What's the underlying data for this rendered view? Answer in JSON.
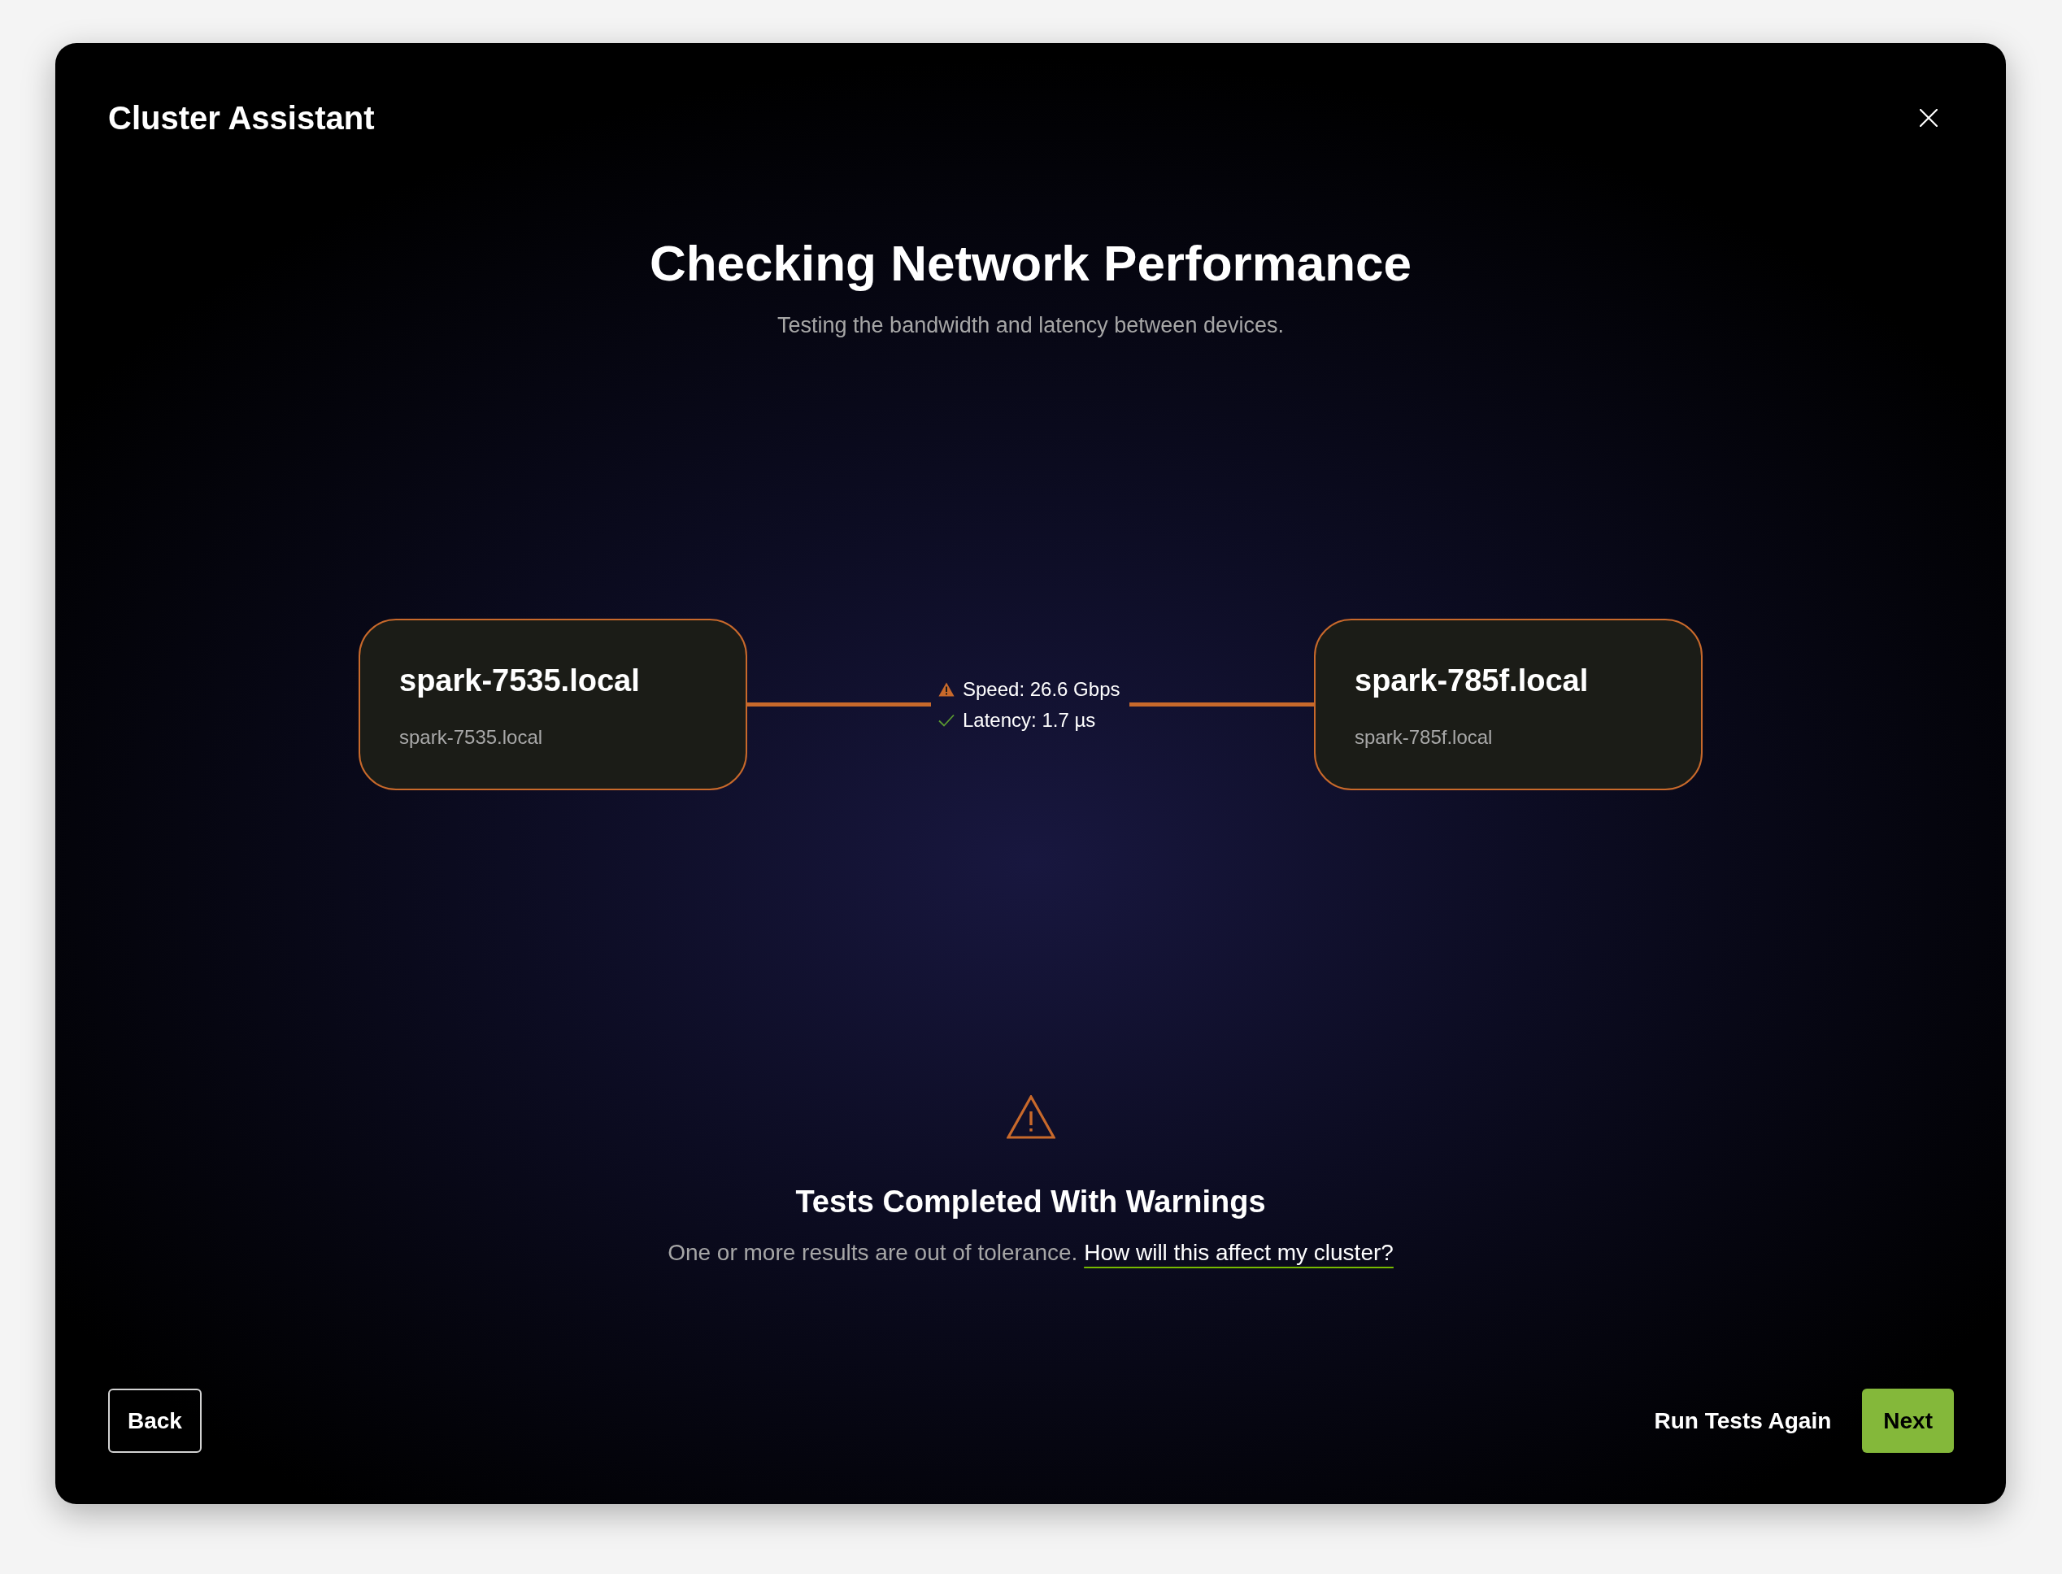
{
  "window": {
    "title": "Cluster Assistant"
  },
  "heading": {
    "title": "Checking Network Performance",
    "subtitle": "Testing the bandwidth and latency between devices."
  },
  "nodes": [
    {
      "name": "spark-7535.local",
      "host": "spark-7535.local"
    },
    {
      "name": "spark-785f.local",
      "host": "spark-785f.local"
    }
  ],
  "link_metrics": [
    {
      "kind": "warning",
      "text": "Speed: 26.6 Gbps"
    },
    {
      "kind": "ok",
      "text": "Latency: 1.7 µs"
    }
  ],
  "result": {
    "kind": "warning",
    "title": "Tests Completed With Warnings",
    "message": "One or more results are out of tolerance.",
    "help_link": "How will this affect my cluster?"
  },
  "footer": {
    "back_button": "Back",
    "retry_button": "Run Tests Again",
    "next_button": "Next"
  }
}
